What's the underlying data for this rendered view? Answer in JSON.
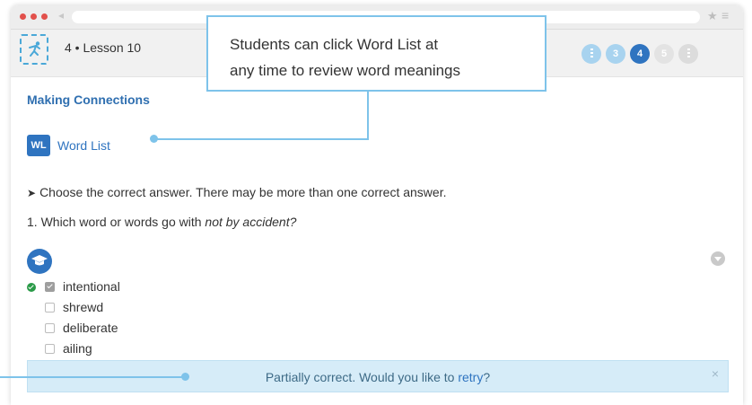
{
  "browser": {
    "back_icon": "back-arrow-icon",
    "star_icon": "star-icon",
    "menu_icon": "menu-icon"
  },
  "header": {
    "lesson_title": "4 • Lesson 10",
    "steps": [
      {
        "label": "",
        "state": "info"
      },
      {
        "label": "3",
        "state": "done"
      },
      {
        "label": "4",
        "state": "current"
      },
      {
        "label": "5",
        "state": "upcoming"
      },
      {
        "label": "",
        "state": "info"
      }
    ]
  },
  "main": {
    "section_title": "Making Connections",
    "word_list": {
      "badge": "WL",
      "label": "Word List"
    },
    "instructions": "Choose the correct answer. There may be more than one correct answer.",
    "question": {
      "prefix": "1. Which word or words go with ",
      "emphasis": "not by accident?"
    },
    "options": [
      {
        "label": "intentional",
        "checked": true,
        "correct": true
      },
      {
        "label": "shrewd",
        "checked": false,
        "correct": false
      },
      {
        "label": "deliberate",
        "checked": false,
        "correct": false
      },
      {
        "label": "ailing",
        "checked": false,
        "correct": false
      }
    ],
    "feedback": {
      "text": "Partially correct. Would you like to ",
      "link": "retry",
      "suffix": "?",
      "close": "×"
    }
  },
  "callout": {
    "line1": "Students can click Word List at",
    "line2": "any time to review word meanings"
  },
  "colors": {
    "accent": "#2f74c0",
    "callout_border": "#7ec3ea",
    "feedback_bg": "#d6ecf8",
    "correct": "#2a9a48"
  }
}
